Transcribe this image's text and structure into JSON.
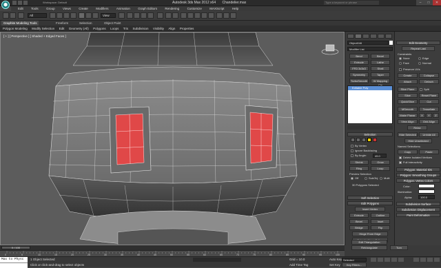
{
  "app": {
    "title": "Autodesk 3ds Max  2012 x64",
    "file": "Chandelier.max",
    "search_placeholder": "Type a keyword or phrase",
    "workspace": "Workspace: Default"
  },
  "window_controls": [
    "–",
    "□",
    "✕"
  ],
  "menu": [
    "Edit",
    "Tools",
    "Group",
    "Views",
    "Create",
    "Modifiers",
    "Animation",
    "Graph Editors",
    "Rendering",
    "Customize",
    "MAXScript",
    "Help"
  ],
  "toolbar": {
    "selection_filter": "All",
    "view_dropdown": "View"
  },
  "ribbon": {
    "tabs": [
      "Graphite Modeling Tools",
      "Freeform",
      "Selection",
      "Object Paint"
    ],
    "items": [
      "Polygon Modeling",
      "Modify Selection",
      "Edit",
      "Geometry (All)",
      "Polygons",
      "Loops",
      "Tris",
      "Subdivision",
      "Visibility",
      "Align",
      "Properties"
    ]
  },
  "viewport": {
    "label": "[ + ] [ Perspective ] [ Shaded + Edged Faces ]"
  },
  "command_panel": {
    "object_name": "Object046",
    "modifier_list": "Modifier List",
    "buttons": [
      "Bend",
      "Bevel",
      "Extrude",
      "Lathe",
      "FFD 3x3x3",
      "Shell",
      "Symmetry",
      "Taper",
      "TurboSmooth",
      "W Mapping Cle"
    ],
    "stack_item": "Editable Poly",
    "selection_title": "Selection",
    "by_vertex": "By Vertex",
    "ignore_backfacing": "Ignore Backfacing",
    "by_angle": "By Angle:",
    "by_angle_value": "45.0",
    "shrink": "Shrink",
    "grow": "Grow",
    "ring": "Ring",
    "loop": "Loop",
    "preview_selection": "Preview Selection",
    "off": "Off",
    "subobj": "SubObj",
    "multi": "Multi",
    "selected_count": "30 Polygons Selected",
    "soft_selection": "Soft Selection",
    "edit_polygons": "Edit Polygons",
    "insert_vertex": "Insert Vertex",
    "extrude": "Extrude",
    "outline": "Outline",
    "bevel": "Bevel",
    "inset": "Inset",
    "bridge": "Bridge",
    "flip": "Flip",
    "hinge": "Hinge From Edge",
    "extrude_spline": "Extrude Along Spline",
    "edit_triangulation": "Edit Triangulation",
    "retriangulate": "Retriangulate",
    "turn": "Turn"
  },
  "right_panel": {
    "edit_geometry": "Edit Geometry",
    "repeat_last": "Repeat Last",
    "constraints": "Constraints",
    "none": "None",
    "edge": "Edge",
    "face": "Face",
    "normal": "Normal",
    "preserve_uvs": "Preserve UVs",
    "create": "Create",
    "collapse": "Collapse",
    "attach": "Attach",
    "detach": "Detach",
    "slice_plane": "Slice Plane",
    "split": "Split",
    "slice": "Slice",
    "reset_plane": "Reset Plane",
    "quickslice": "QuickSlice",
    "cut": "Cut",
    "msmooth": "MSmooth",
    "tessellate": "Tessellate",
    "make_planar": "Make Planar",
    "x": "X",
    "y": "Y",
    "z": "Z",
    "view_align": "View Align",
    "grid_align": "Grid Align",
    "relax": "Relax",
    "hide_selected": "Hide Selected",
    "unhide_all": "Unhide All",
    "hide_unselected": "Hide Unselected",
    "named_selections": "Named Selections:",
    "copy": "Copy",
    "paste": "Paste",
    "delete_isolated": "Delete Isolated Vertices",
    "full_interactivity": "Full Interactivity",
    "polygon_material_ids": "Polygon: Material IDs",
    "polygon_smoothing": "Polygon: Smoothing Groups",
    "polygon_vertex_colors": "Polygon: Vertex Colors",
    "color": "Color:",
    "illumination": "Illumination:",
    "alpha": "Alpha:",
    "alpha_value": "100.0",
    "subdivision_surface": "Subdivision Surface",
    "subdivision_displacement": "Subdivision Displacement",
    "paint_deformation": "Paint Deformation"
  },
  "timeline": {
    "frame": "0 / 100",
    "ticks": [
      "0",
      "5",
      "10",
      "15",
      "20",
      "25",
      "30",
      "35",
      "40",
      "45",
      "50",
      "55",
      "60",
      "65",
      "70",
      "75",
      "80",
      "85",
      "90",
      "95",
      "100"
    ]
  },
  "status": {
    "maxscript": "Max to Physc",
    "objects_selected": "1 Object Selected",
    "prompt": "Click or click-and-drag to select objects",
    "grid": "Grid = 10.0",
    "add_time_tag": "Add Time Tag",
    "auto_key": "Auto Key",
    "selected": "Selected",
    "set_key": "Set Key",
    "key_filters": "Key Filters..."
  },
  "colors": {
    "selected_poly": "#e04848",
    "accent_yellow": "#f2d200"
  }
}
